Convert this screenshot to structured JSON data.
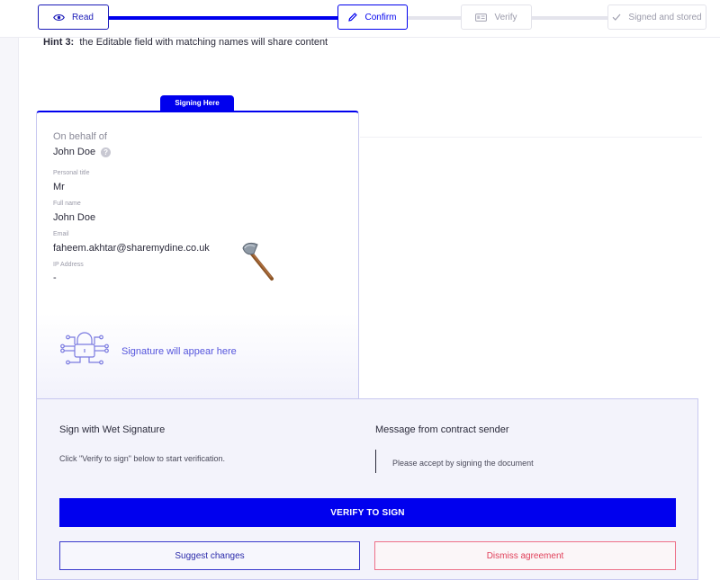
{
  "progress": {
    "steps": [
      {
        "label": "Read",
        "icon": "eye-icon",
        "state": "done"
      },
      {
        "label": "Confirm",
        "icon": "pencil-icon",
        "state": "current"
      },
      {
        "label": "Verify",
        "icon": "id-card-icon",
        "state": "pending"
      },
      {
        "label": "Signed and stored",
        "icon": "check-icon",
        "state": "pending"
      }
    ],
    "colors": {
      "accent": "#0000ee",
      "track": "#e4e4ec"
    }
  },
  "hint": {
    "prefix": "Hint 3:",
    "text": "the Editable field with matching names will share content"
  },
  "signing": {
    "tab_label": "Signing Here",
    "behalf_label": "On behalf of",
    "behalf_name": "John Doe",
    "fields": [
      {
        "label": "Personal title",
        "value": "Mr"
      },
      {
        "label": "Full name",
        "value": "John Doe"
      },
      {
        "label": "Email",
        "value": "faheem.akhtar@sharemydine.co.uk"
      },
      {
        "label": "IP Address",
        "value": "-"
      }
    ],
    "signature_placeholder": "Signature will appear here",
    "signature_icon": "lock-circuit-icon"
  },
  "panel": {
    "wet_title": "Sign with Wet Signature",
    "wet_text": "Click \"Verify to sign\" below to start verification.",
    "msg_title": "Message from contract sender",
    "msg_text": "Please accept by signing the document",
    "verify_label": "VERIFY TO SIGN",
    "suggest_label": "Suggest changes",
    "dismiss_label": "Dismiss agreement"
  }
}
